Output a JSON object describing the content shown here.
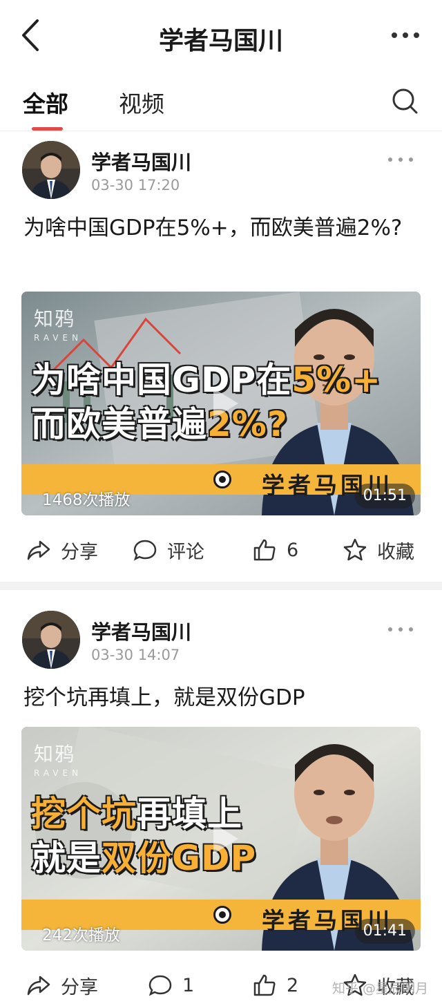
{
  "header": {
    "title": "学者马国川",
    "back_icon": "back-chevron-icon",
    "more_icon": "more-dots-icon"
  },
  "tabs": [
    {
      "label": "全部",
      "active": true
    },
    {
      "label": "视频",
      "active": false
    }
  ],
  "search_icon": "search-icon",
  "posts": [
    {
      "author": "学者马国川",
      "time": "03-30 17:20",
      "text": "为啥中国GDP在5%+，而欧美普遍2%?",
      "video": {
        "watermark_cn": "知鸦",
        "watermark_en": "RAVEN",
        "headline_line1_a": "为啥中国GDP在",
        "headline_line1_b": "5%+",
        "headline_line2_a": "而欧美普遍",
        "headline_line2_b": "2%?",
        "band_name": "学者马国川",
        "plays": "1468次播放",
        "duration": "01:51"
      },
      "actions": {
        "share": "分享",
        "comment": "评论",
        "like": "6",
        "favorite": "收藏"
      }
    },
    {
      "author": "学者马国川",
      "time": "03-30 14:07",
      "text": "挖个坑再填上，就是双份GDP",
      "video": {
        "watermark_cn": "知鸦",
        "watermark_en": "RAVEN",
        "headline_line1_a": "挖个坑",
        "headline_line1_b": "再填上",
        "headline_line2_a": "就是",
        "headline_line2_b": "双份GDP",
        "band_name": "学者马国川",
        "plays": "242次播放",
        "duration": "01:41"
      },
      "actions": {
        "share": "分享",
        "comment": "1",
        "like": "2",
        "favorite": "收藏"
      }
    }
  ],
  "footer_watermark": "知乎 @星辰明月",
  "colors": {
    "accent": "#e04a48",
    "band": "#f5b53a",
    "highlight": "#f7b035"
  }
}
